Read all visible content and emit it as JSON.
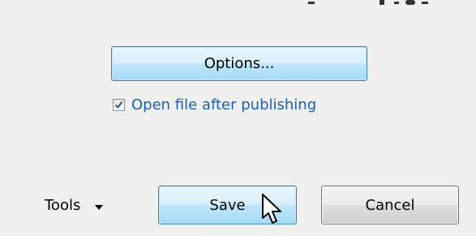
{
  "options_button": {
    "label": "Options..."
  },
  "open_after_publish": {
    "label": "Open file after publishing",
    "checked": true
  },
  "footer": {
    "tools_label": "Tools",
    "save_label": "Save",
    "cancel_label": "Cancel"
  },
  "colors": {
    "dialog_background": "#f0f0f0",
    "link_blue": "#1a5fb4",
    "button_focus_border": "#3c7fb1"
  },
  "icons": {
    "tools_dropdown": "caret-down-icon",
    "cursor": "mouse-pointer-icon",
    "checkbox_mark": "checkmark-icon"
  }
}
